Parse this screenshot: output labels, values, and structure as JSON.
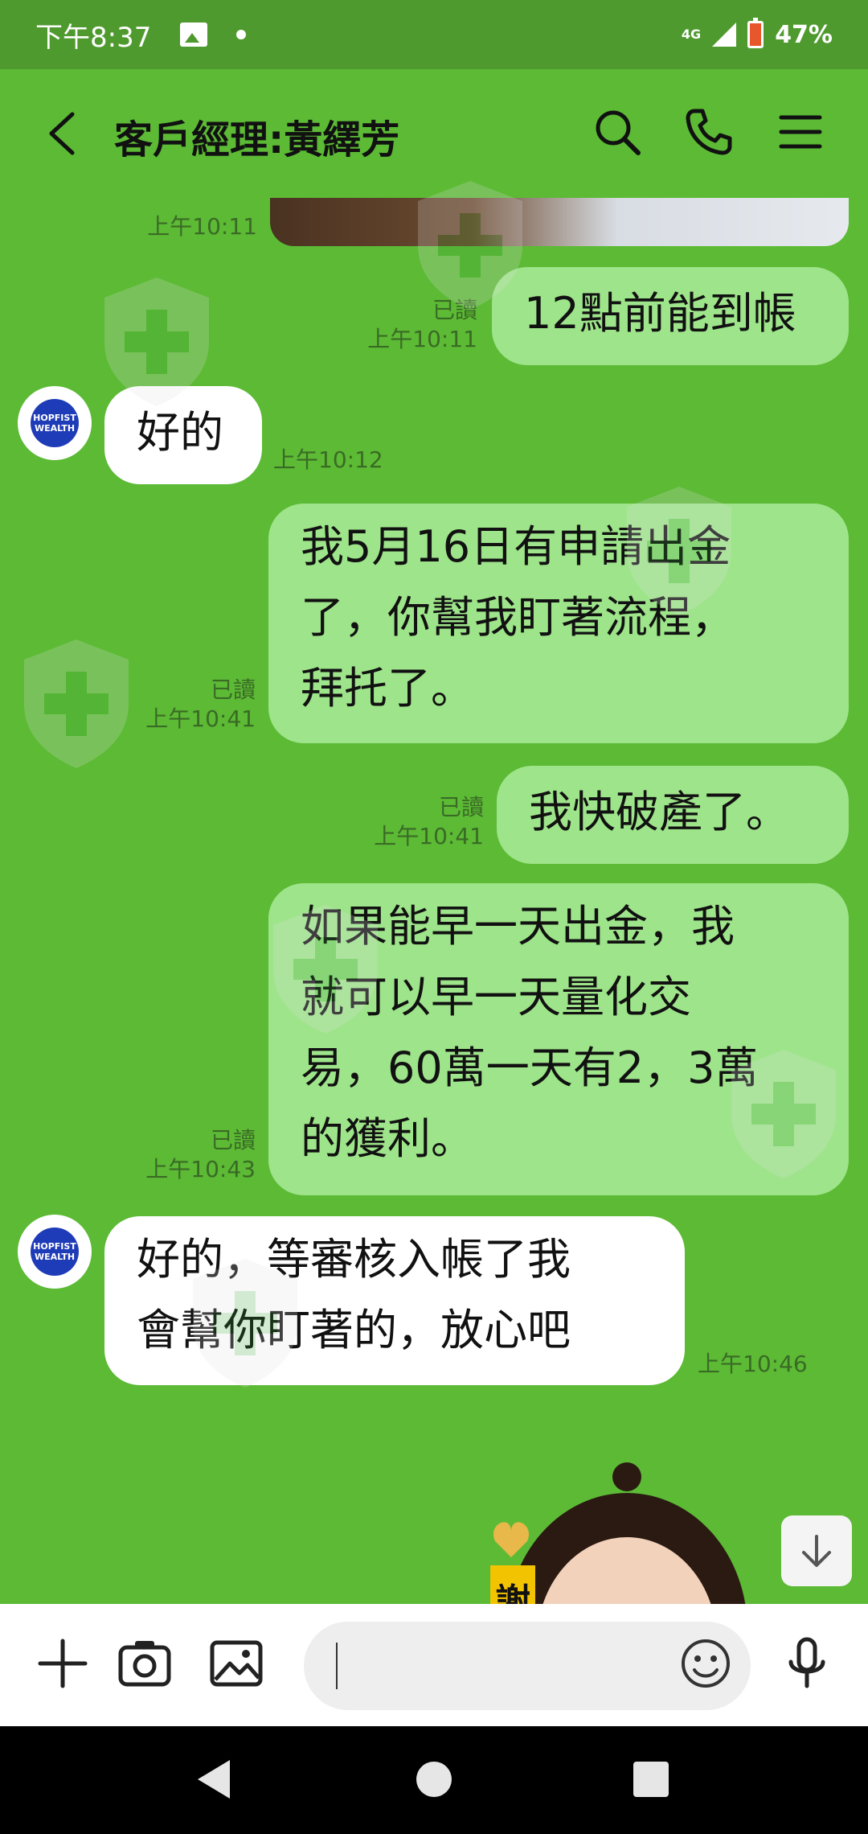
{
  "status_bar": {
    "time": "下午8:37",
    "network": "4G",
    "battery": "47%"
  },
  "header": {
    "title": "客戶經理:黃繹芳"
  },
  "messages": [
    {
      "type": "image_tail",
      "meta_time": "上午10:11"
    },
    {
      "type": "out",
      "text": "12點前能到帳",
      "read": "已讀",
      "time": "上午10:11"
    },
    {
      "type": "in",
      "text": "好的",
      "time": "上午10:12"
    },
    {
      "type": "out",
      "lines": [
        "我5月16日有申請出金",
        "了，你幫我盯著流程，",
        "拜托了。"
      ],
      "read": "已讀",
      "time": "上午10:41"
    },
    {
      "type": "out",
      "text": "我快破產了。",
      "read": "已讀",
      "time": "上午10:41"
    },
    {
      "type": "out",
      "lines": [
        "如果能早一天出金，我",
        "就可以早一天量化交",
        "易，60萬一天有2，3萬",
        "的獲利。"
      ],
      "read": "已讀",
      "time": "上午10:43"
    },
    {
      "type": "in",
      "lines": [
        "好的，等審核入帳了我",
        "會幫你盯著的，放心吧"
      ],
      "time": "上午10:46"
    }
  ],
  "avatar": {
    "lines": [
      "HOPFIST",
      "WEALTH"
    ]
  },
  "sticker": {
    "text": "謝"
  },
  "icons": {
    "back": "back-arrow-icon",
    "search": "search-icon",
    "call": "phone-icon",
    "menu": "menu-icon",
    "add": "plus-icon",
    "camera": "camera-icon",
    "gallery": "image-icon",
    "emoji": "emoji-icon",
    "voice": "microphone-icon",
    "scroll_down": "arrow-down-icon"
  },
  "colors": {
    "background": "#5cba35",
    "outgoing_bubble": "#9ee48a",
    "incoming_bubble": "#ffffff"
  }
}
